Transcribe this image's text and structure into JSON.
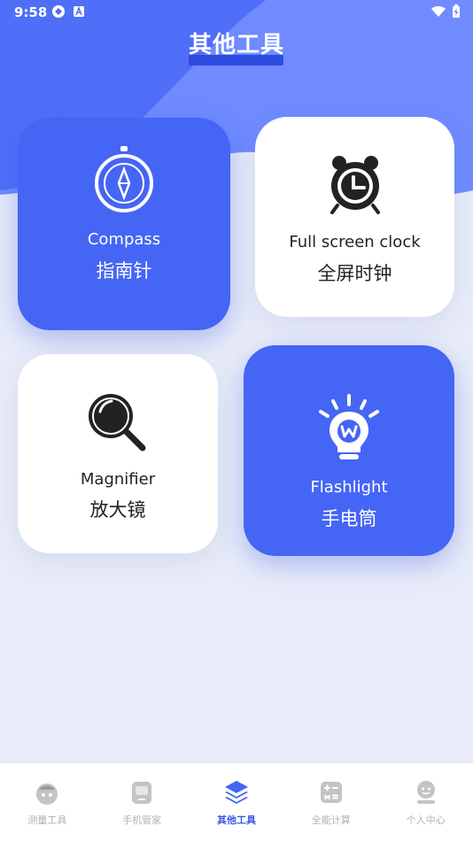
{
  "status_bar": {
    "time": "9:58"
  },
  "header": {
    "title": "其他工具"
  },
  "tools": [
    {
      "name_en": "Compass",
      "name_zh": "指南针"
    },
    {
      "name_en": "Full screen clock",
      "name_zh": "全屏时钟"
    },
    {
      "name_en": "Magnifier",
      "name_zh": "放大镜"
    },
    {
      "name_en": "Flashlight",
      "name_zh": "手电筒"
    }
  ],
  "tabbar": {
    "active_index": 2,
    "items": [
      {
        "label": "测量工具",
        "icon": "measure-icon"
      },
      {
        "label": "手机管家",
        "icon": "phone-icon"
      },
      {
        "label": "其他工具",
        "icon": "layers-icon"
      },
      {
        "label": "全能计算",
        "icon": "calculator-icon"
      },
      {
        "label": "个人中心",
        "icon": "person-icon"
      }
    ]
  },
  "colors": {
    "accent": "#4565f5",
    "background": "#e8ecf8",
    "inactive": "#b0b0b0"
  }
}
